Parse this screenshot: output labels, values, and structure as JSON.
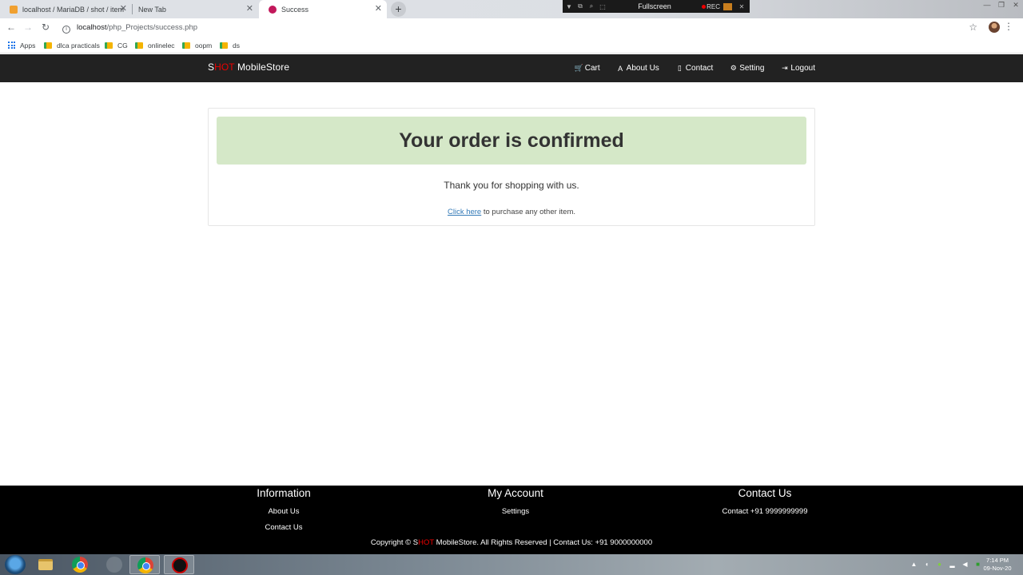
{
  "browser": {
    "tabs": [
      {
        "title": "localhost / MariaDB / shot / item",
        "active": false
      },
      {
        "title": "New Tab",
        "active": false
      },
      {
        "title": "Success",
        "active": true
      }
    ],
    "recorder": {
      "title": "Fullscreen",
      "rec_label": "REC"
    },
    "url_host": "localhost",
    "url_path": "/php_Projects/success.php",
    "bookmarks": [
      "Apps",
      "dlca practicals",
      "CG",
      "onlinelec",
      "oopm",
      "ds"
    ]
  },
  "site": {
    "brand_s": "S",
    "brand_hot": "HOT",
    "brand_rest": " MobileStore",
    "nav": [
      {
        "icon": "cart-icon",
        "glyph": "🛒",
        "label": "Cart"
      },
      {
        "icon": "font-icon",
        "glyph": "A",
        "label": "About Us"
      },
      {
        "icon": "phone-icon",
        "glyph": "▯",
        "label": "Contact"
      },
      {
        "icon": "gear-icon",
        "glyph": "⚙",
        "label": "Setting"
      },
      {
        "icon": "logout-icon",
        "glyph": "⇥",
        "label": "Logout"
      }
    ]
  },
  "main": {
    "heading": "Your order is confirmed",
    "thanks": "Thank you for shopping with us.",
    "link_text": "Click here",
    "link_suffix": " to purchase any other item."
  },
  "footer": {
    "columns": [
      {
        "heading": "Information",
        "items": [
          "About Us",
          "Contact Us"
        ]
      },
      {
        "heading": "My Account",
        "items": [
          "Settings"
        ]
      },
      {
        "heading": "Contact Us",
        "items": [
          "Contact +91 9999999999"
        ]
      }
    ],
    "copyright_prefix": "Copyright © ",
    "copyright_s": "S",
    "copyright_hot": "HOT",
    "copyright_suffix": " MobileStore. All Rights Reserved | Contact Us: +91 9000000000"
  },
  "taskbar": {
    "time": "7:14 PM",
    "date": "09-Nov-20"
  }
}
